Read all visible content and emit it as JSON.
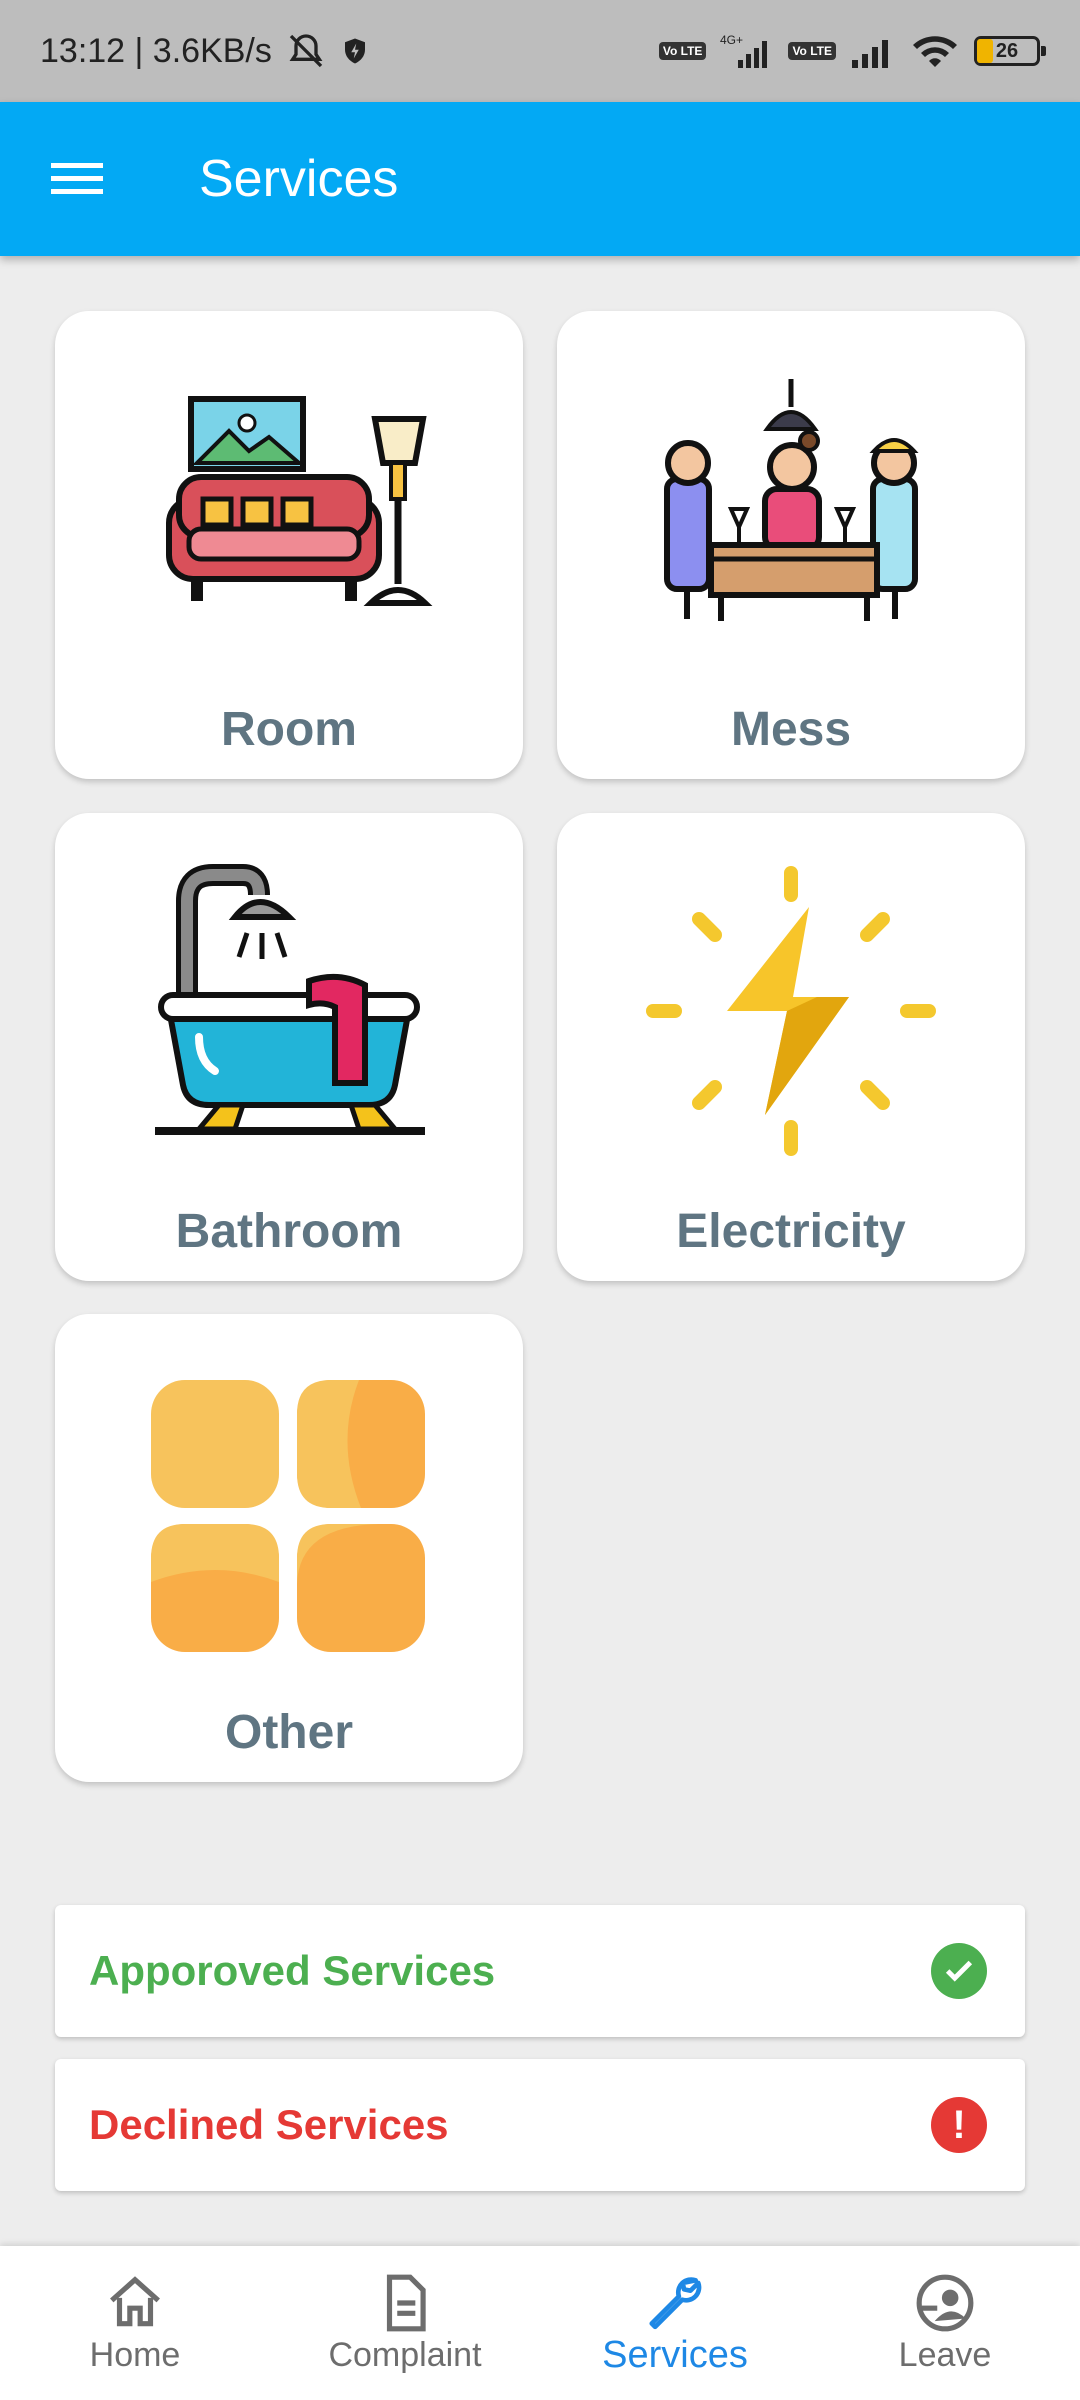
{
  "status_bar": {
    "time_speed": "13:12 | 3.6KB/s",
    "volte1": "Vo LTE",
    "network": "4G+",
    "volte2": "Vo LTE",
    "battery": "26"
  },
  "app_bar": {
    "title": "Services"
  },
  "services": [
    {
      "label": "Room",
      "icon": "sofa-lamp-icon"
    },
    {
      "label": "Mess",
      "icon": "dining-table-icon"
    },
    {
      "label": "Bathroom",
      "icon": "bathtub-icon"
    },
    {
      "label": "Electricity",
      "icon": "lightning-icon"
    },
    {
      "label": "Other",
      "icon": "grid-squares-icon"
    }
  ],
  "status_links": {
    "approved": {
      "label": "Apporoved Services",
      "color": "#4caf50",
      "icon": "check-circle-icon"
    },
    "declined": {
      "label": "Declined Services",
      "color": "#e53935",
      "icon": "alert-circle-icon"
    }
  },
  "bottom_nav": {
    "items": [
      {
        "label": "Home",
        "icon": "home-icon"
      },
      {
        "label": "Complaint",
        "icon": "document-icon"
      },
      {
        "label": "Services",
        "icon": "wrench-icon",
        "active": true
      },
      {
        "label": "Leave",
        "icon": "person-exit-icon"
      }
    ]
  },
  "colors": {
    "app_bar": "#03a9f4",
    "active_nav": "#1e88e5",
    "card_label": "#5f7582"
  }
}
